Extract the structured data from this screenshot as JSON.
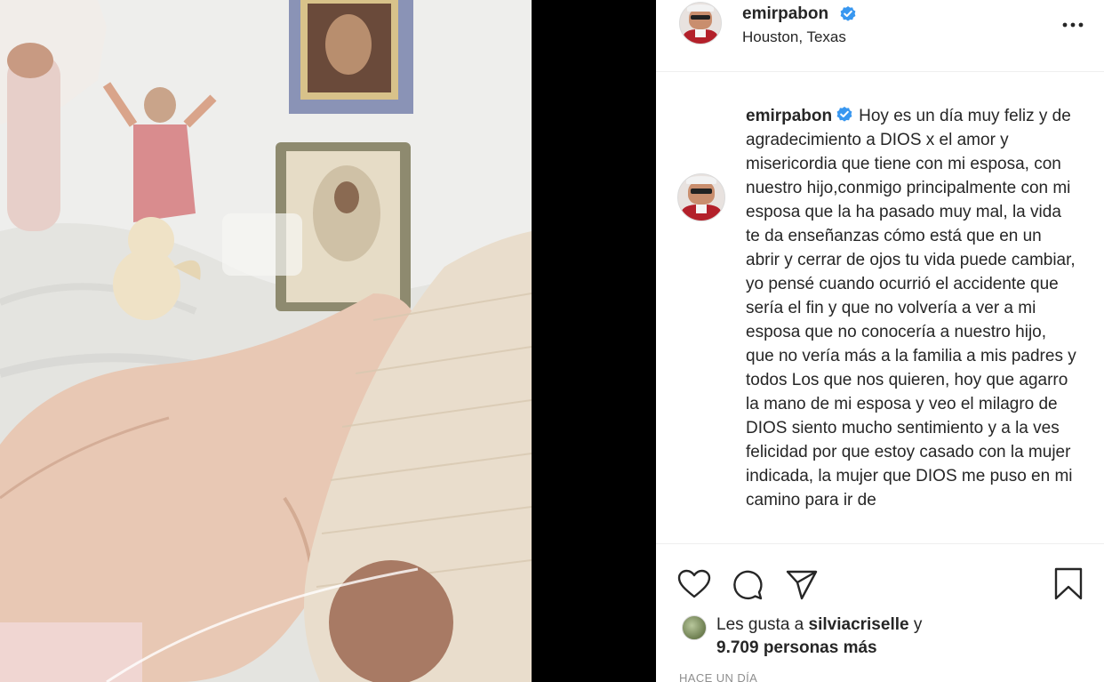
{
  "post": {
    "username": "emirpabon",
    "location": "Houston, Texas",
    "verified": true,
    "more_icon": "more-horizontal-icon"
  },
  "caption": {
    "username": "emirpabon",
    "text": "Hoy es un día muy feliz y de agradecimiento a DIOS x el amor y misericordia que tiene con mi esposa, con nuestro hijo,conmigo principalmente con mi esposa que la ha pasado muy mal, la vida te da enseñanzas cómo está que en un abrir y cerrar de ojos tu vida puede cambiar, yo pensé cuando ocurrió el accidente que sería el fin y que no volvería a ver a mi esposa que no conocería a nuestro hijo, que no vería más a la familia a mis padres y todos Los que nos quieren, hoy que agarro la mano de mi esposa y veo el milagro de DIOS siento mucho sentimiento y a la ves felicidad por que estoy casado con la mujer indicada, la mujer que DIOS me puso en mi camino para ir de"
  },
  "actions": {
    "like": "heart-icon",
    "comment": "comment-bubble-icon",
    "share": "paper-plane-icon",
    "save": "bookmark-icon"
  },
  "likes": {
    "prefix": "Les gusta a",
    "user": "silviacriselle",
    "conjunction": "y",
    "others": "9.709 personas más"
  },
  "timestamp": "Hace un día",
  "colors": {
    "verified_blue": "#3897f0",
    "text": "#262626",
    "muted": "#8e8e8e",
    "divider": "#efefef"
  }
}
